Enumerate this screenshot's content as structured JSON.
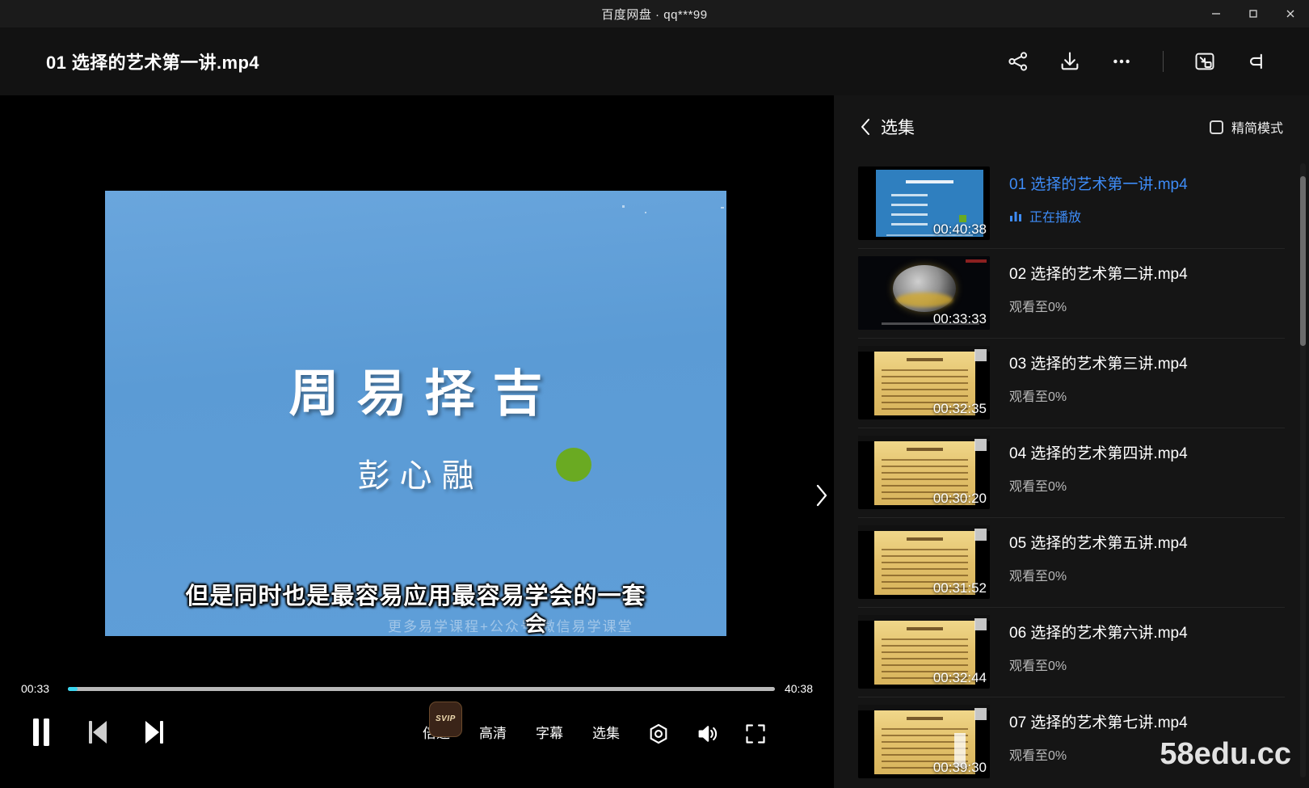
{
  "window": {
    "title": "百度网盘 · qq***99",
    "controls": {
      "minimize": "minimize-icon",
      "maximize": "maximize-icon",
      "close": "close-icon"
    }
  },
  "header": {
    "file_title": "01 选择的艺术第一讲.mp4",
    "actions": [
      {
        "name": "share-icon",
        "label": "分享"
      },
      {
        "name": "download-icon",
        "label": "下载"
      },
      {
        "name": "more-icon",
        "label": "更多"
      },
      {
        "name": "picture-in-picture-icon",
        "label": "小窗播放"
      },
      {
        "name": "collapse-sidebar-icon",
        "label": "收起侧栏"
      }
    ]
  },
  "video": {
    "title": "周易择吉",
    "author": "彭心融",
    "watermark": "更多易学课程+公众号:微信易学课堂",
    "subtitle": "但是同时也是最容易应用最容易学会的一套",
    "subtitle_tail": "会",
    "next_label": "下一集",
    "background_color": "#5b9bd5",
    "dot_color": "#6aaa22"
  },
  "controls": {
    "current_time": "00:33",
    "total_time": "40:38",
    "progress_percent": 1.4,
    "progress_color": "#3ad6f0",
    "play_state": "pause",
    "buttons": [
      {
        "name": "pause-button",
        "label": "暂停"
      },
      {
        "name": "previous-button",
        "label": "上一集"
      },
      {
        "name": "next-button",
        "label": "下一集"
      }
    ],
    "speed_label": "倍速",
    "speed_badge": "SVIP",
    "quality_label": "高清",
    "subtitle_label": "字幕",
    "episodes_label": "选集",
    "settings_label": "设置",
    "volume_label": "音量",
    "fullscreen_label": "全屏"
  },
  "sidebar": {
    "back_label": "选集",
    "simple_mode_label": "精简模式",
    "simple_mode_checked": false,
    "episodes": [
      {
        "name": "01 选择的艺术第一讲.mp4",
        "duration": "00:40:38",
        "status": "正在播放",
        "active": true,
        "thumb": "slide-blue"
      },
      {
        "name": "02 选择的艺术第二讲.mp4",
        "duration": "00:33:33",
        "status": "观看至0%",
        "active": false,
        "thumb": "globe"
      },
      {
        "name": "03 选择的艺术第三讲.mp4",
        "duration": "00:32:35",
        "status": "观看至0%",
        "active": false,
        "thumb": "paper"
      },
      {
        "name": "04 选择的艺术第四讲.mp4",
        "duration": "00:30:20",
        "status": "观看至0%",
        "active": false,
        "thumb": "paper"
      },
      {
        "name": "05 选择的艺术第五讲.mp4",
        "duration": "00:31:52",
        "status": "观看至0%",
        "active": false,
        "thumb": "paper"
      },
      {
        "name": "06 选择的艺术第六讲.mp4",
        "duration": "00:32:44",
        "status": "观看至0%",
        "active": false,
        "thumb": "paper"
      },
      {
        "name": "07 选择的艺术第七讲.mp4",
        "duration": "00:39:30",
        "status": "观看至0%",
        "active": false,
        "thumb": "paper"
      }
    ]
  },
  "overlay": {
    "site_watermark": "58edu.cc"
  }
}
